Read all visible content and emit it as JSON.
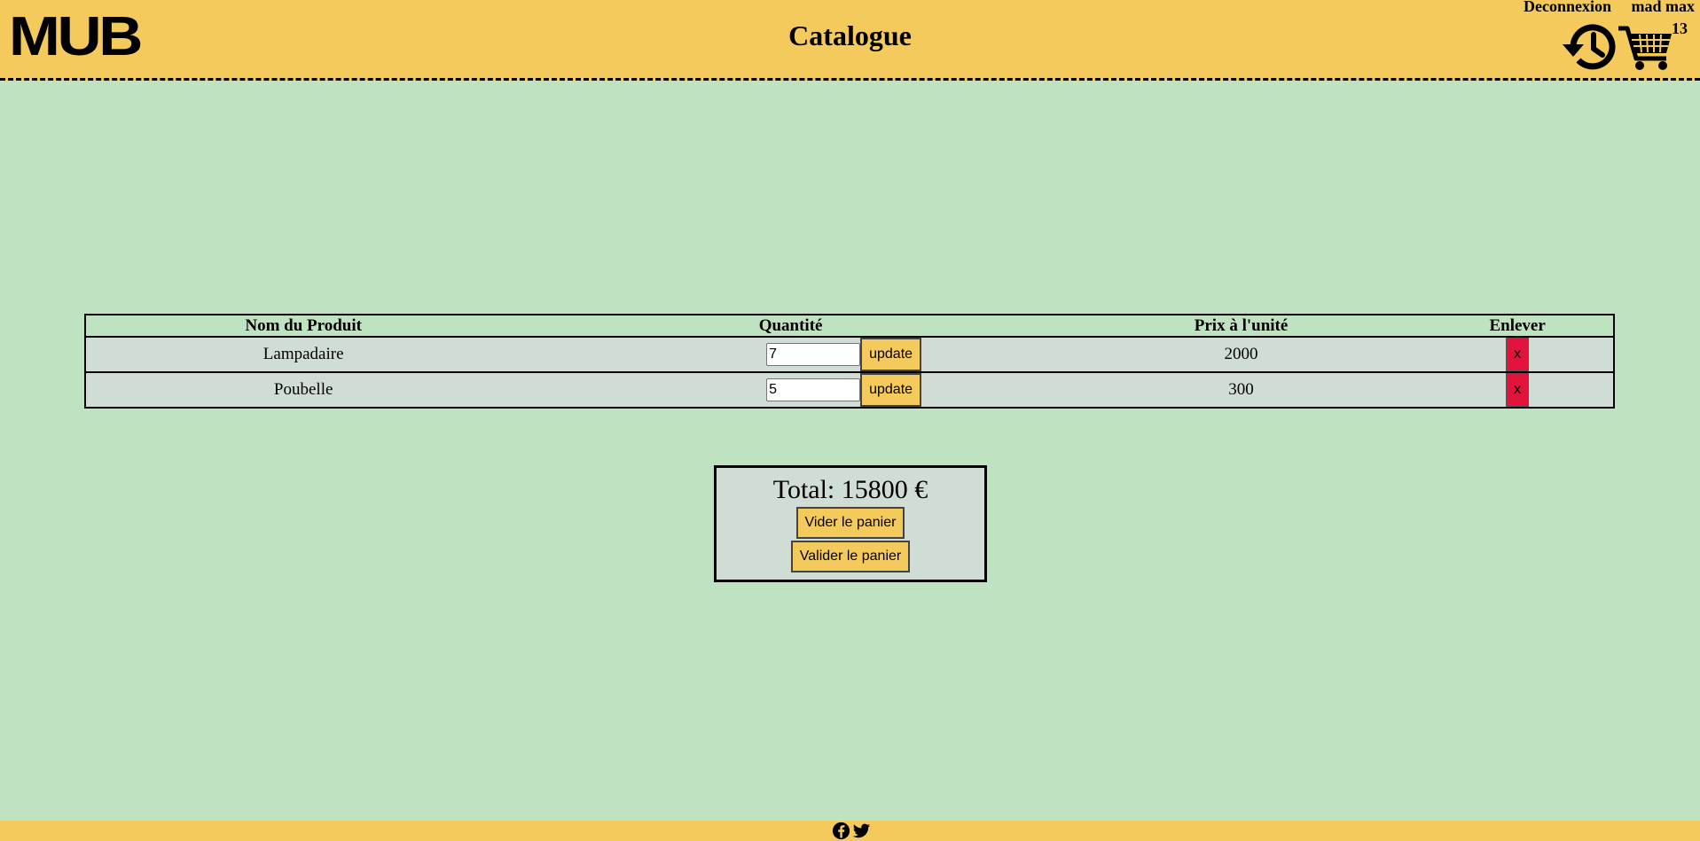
{
  "header": {
    "logo": "MUB",
    "title": "Catalogue",
    "logout": "Deconnexion",
    "username": "mad max",
    "cart_count": "13"
  },
  "table": {
    "headers": [
      "Nom du Produit",
      "Quantité",
      "Prix à l'unité",
      "Enlever"
    ],
    "rows": [
      {
        "name": "Lampadaire",
        "quantity": "7",
        "update": "update",
        "price": "2000",
        "remove": "x"
      },
      {
        "name": "Poubelle",
        "quantity": "5",
        "update": "update",
        "price": "300",
        "remove": "x"
      }
    ]
  },
  "summary": {
    "total": "Total: 15800 €",
    "empty_cart": "Vider le panier",
    "validate_cart": "Valider le panier"
  },
  "icons": {
    "history": "history-icon",
    "cart": "cart-icon",
    "facebook": "facebook-icon",
    "twitter": "twitter-icon"
  },
  "colors": {
    "header_bg": "#f5ca5c",
    "page_bg": "#bfe3c0",
    "row_bg": "#cfddd4",
    "remove_btn": "#e0143c"
  }
}
